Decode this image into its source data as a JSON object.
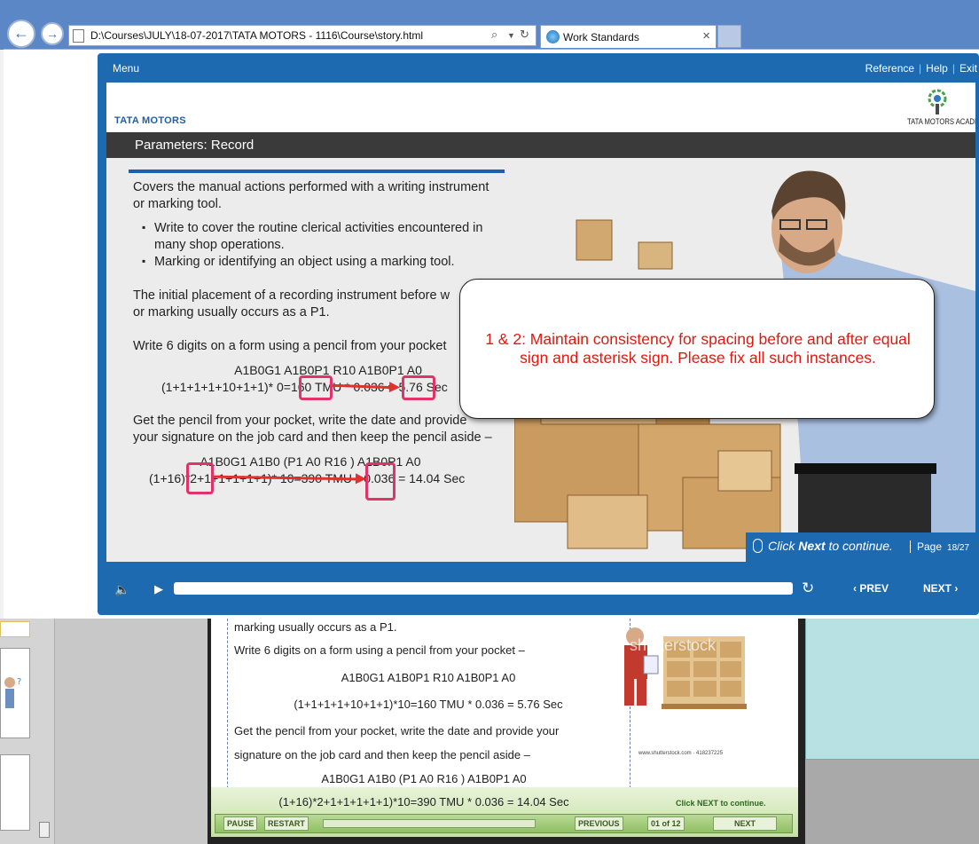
{
  "browser": {
    "url": "D:\\Courses\\JULY\\18-07-2017\\TATA MOTORS - 1116\\Course\\story.html",
    "tab_title": "Work Standards",
    "back_glyph": "←",
    "forward_glyph": "→",
    "search_glyph": "⌕",
    "refresh_glyph": "↻",
    "close_glyph": "×"
  },
  "player": {
    "menu_label": "Menu",
    "reference_label": "Reference",
    "help_label": "Help",
    "exit_label": "Exit",
    "brand_logo": "TATA MOTORS",
    "academy_logo": "TATA MOTORS ACADEMY",
    "slide_title": "Parameters: Record",
    "intro_line1": "Covers the manual actions performed with a writing instrument",
    "intro_line2": "or marking tool.",
    "bullet1_line1": "Write to cover the routine clerical activities encountered in",
    "bullet1_line2": "many shop operations.",
    "bullet2": "Marking or identifying an object using a marking tool.",
    "para2_line1": "The initial placement of a recording instrument before w",
    "para2_line2": "or marking usually occurs as a P1.",
    "para3": "Write 6 digits on a form using a pencil from your pocket",
    "eq1_line1": "A1B0G1  A1B0P1 R10 A1B0P1 A0",
    "eq1_line2": "(1+1+1+1+10+1+1)* 0=160 TMU * 0.036 = 5.76 Sec",
    "para4_line1": "Get the pencil from your pocket, write the date and provide",
    "para4_line2": "your signature on the job card and then keep the pencil aside –",
    "eq2_line1": "A1B0G1  A1B0  (P1  A0  R16 ) A1B0P1 A0",
    "eq2_line2": "(1+16)*2+1+1+1+1+1)* 10=390 TMU * 0.036 = 14.04 Sec",
    "review_note": "1 & 2: Maintain consistency for spacing before and after equal sign and asterisk sign. Please fix all such instances.",
    "continue_prefix": "Click ",
    "continue_bold": "Next",
    "continue_suffix": " to continue.",
    "page_label": "Page",
    "page_number": "18/27",
    "prev_label": "PREV",
    "next_label": "NEXT",
    "volume_icon": "speaker-icon",
    "play_glyph": "▶",
    "volume_glyph": "🔈",
    "replay_glyph": "↻",
    "prev_chevron": "‹",
    "next_chevron": "›"
  },
  "editor_slide": {
    "line0": "marking usually occurs as a P1.",
    "line1": "Write 6 digits on a form using a pencil from your pocket –",
    "line2": "A1B0G1   A1B0P1 R10  A1B0P1 A0",
    "line3": "(1+1+1+1+10+1+1)*10=160  TMU * 0.036 = 5.76 Sec",
    "line4": "Get the pencil from your pocket, write the date and provide your",
    "line5": "signature on the job card and then keep the pencil aside –",
    "line6": "A1B0G1   A1B0  (P1  A0  R16 ) A1B0P1  A0",
    "line7": "(1+16)*2+1+1+1+1+1)*10=390  TMU * 0.036 = 14.04 Sec",
    "watermark": "shutterstock",
    "stock_url": "www.shutterstock.com · 418237225",
    "click_next": "Click NEXT to continue.",
    "pause": "PAUSE",
    "restart": "RESTART",
    "previous": "PREVIOUS",
    "counter": "01 of 12",
    "next": "NEXT"
  },
  "colors": {
    "player_blue": "#1d6ab0",
    "note_red": "#e0180f",
    "highlight_pink": "#e0336a"
  }
}
